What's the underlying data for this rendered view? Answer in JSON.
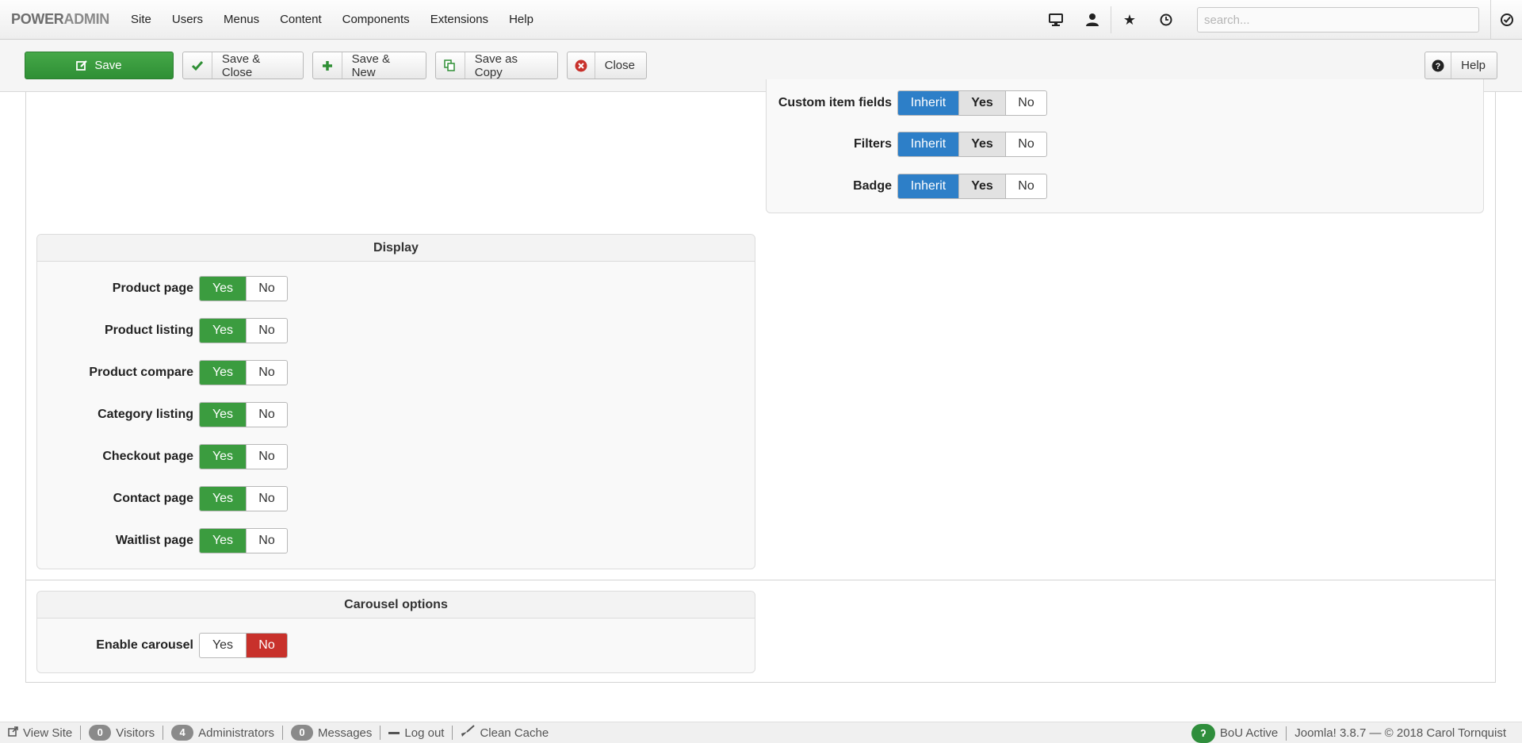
{
  "brand": {
    "dark": "POWER",
    "light": "ADMIN"
  },
  "nav": {
    "menu": [
      "Site",
      "Users",
      "Menus",
      "Content",
      "Components",
      "Extensions",
      "Help"
    ],
    "search_placeholder": "search..."
  },
  "toolbar": {
    "save": "Save",
    "save_close": "Save & Close",
    "save_new": "Save & New",
    "save_copy": "Save as Copy",
    "close": "Close",
    "help": "Help"
  },
  "top_panel": {
    "rows": [
      {
        "label": "Custom item fields",
        "options": [
          "Inherit",
          "Yes",
          "No"
        ],
        "selected": "Inherit"
      },
      {
        "label": "Filters",
        "options": [
          "Inherit",
          "Yes",
          "No"
        ],
        "selected": "Inherit"
      },
      {
        "label": "Badge",
        "options": [
          "Inherit",
          "Yes",
          "No"
        ],
        "selected": "Inherit"
      }
    ]
  },
  "display": {
    "title": "Display",
    "rows": [
      {
        "label": "Product page",
        "yes": "Yes",
        "no": "No",
        "selected": "Yes"
      },
      {
        "label": "Product listing",
        "yes": "Yes",
        "no": "No",
        "selected": "Yes"
      },
      {
        "label": "Product compare",
        "yes": "Yes",
        "no": "No",
        "selected": "Yes"
      },
      {
        "label": "Category listing",
        "yes": "Yes",
        "no": "No",
        "selected": "Yes"
      },
      {
        "label": "Checkout page",
        "yes": "Yes",
        "no": "No",
        "selected": "Yes"
      },
      {
        "label": "Contact page",
        "yes": "Yes",
        "no": "No",
        "selected": "Yes"
      },
      {
        "label": "Waitlist page",
        "yes": "Yes",
        "no": "No",
        "selected": "Yes"
      }
    ]
  },
  "carousel": {
    "title": "Carousel options",
    "rows": [
      {
        "label": "Enable carousel",
        "yes": "Yes",
        "no": "No",
        "selected": "No"
      }
    ]
  },
  "status": {
    "view_site": "View Site",
    "visitors_count": "0",
    "visitors": "Visitors",
    "admins_count": "4",
    "admins": "Administrators",
    "messages_count": "0",
    "messages": "Messages",
    "logout": "Log out",
    "clean_cache": "Clean Cache",
    "bou": "BoU Active",
    "footer": "Joomla! 3.8.7  —  © 2018 Carol Tornquist"
  },
  "colors": {
    "green": "#3b9c3f",
    "red": "#c8312b",
    "blue": "#2d7fc8"
  }
}
